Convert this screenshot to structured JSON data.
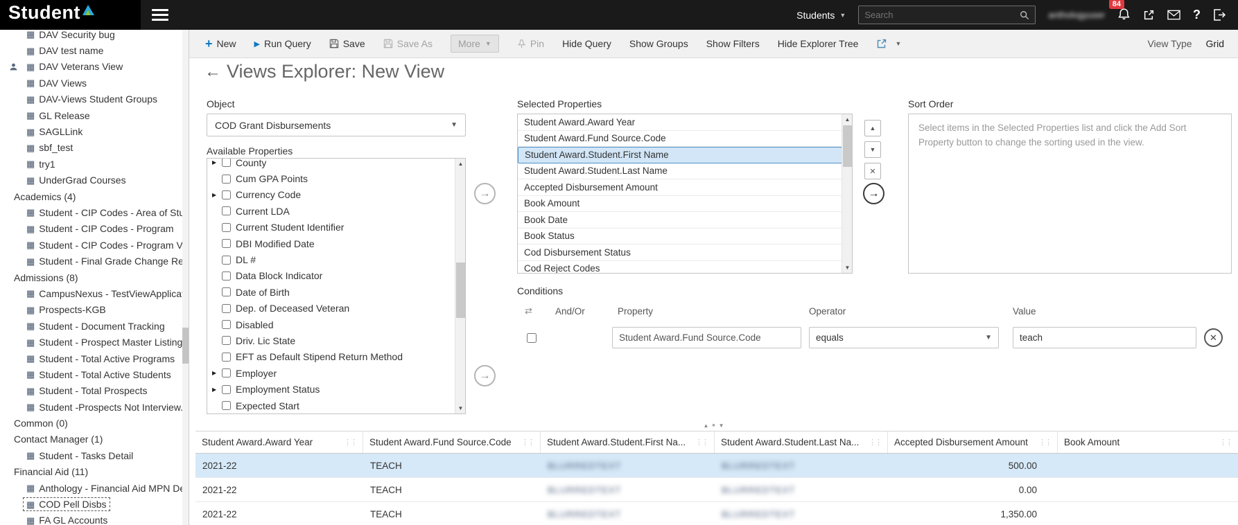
{
  "topbar": {
    "logo_text": "Student",
    "context_selector": {
      "value": "Students"
    },
    "search": {
      "placeholder": "Search"
    },
    "user_display_blurred": "anthologyuser",
    "notifications": {
      "badge": "84"
    }
  },
  "sidebar": {
    "nodes": [
      {
        "kind": "item",
        "label": "DAV Security bug"
      },
      {
        "kind": "item",
        "label": "DAV test name"
      },
      {
        "kind": "item",
        "label": "DAV Veterans View",
        "shared": true
      },
      {
        "kind": "item",
        "label": "DAV Views"
      },
      {
        "kind": "item",
        "label": "DAV-Views Student Groups"
      },
      {
        "kind": "item",
        "label": "GL Release"
      },
      {
        "kind": "item",
        "label": "SAGLLink"
      },
      {
        "kind": "item",
        "label": "sbf_test"
      },
      {
        "kind": "item",
        "label": "try1"
      },
      {
        "kind": "item",
        "label": "UnderGrad Courses"
      },
      {
        "kind": "header",
        "label": "Academics (4)"
      },
      {
        "kind": "item",
        "label": "Student - CIP Codes - Area of Stu..."
      },
      {
        "kind": "item",
        "label": "Student - CIP Codes - Program"
      },
      {
        "kind": "item",
        "label": "Student - CIP Codes - Program Ve..."
      },
      {
        "kind": "item",
        "label": "Student - Final Grade Change Rea..."
      },
      {
        "kind": "header",
        "label": "Admissions (8)"
      },
      {
        "kind": "item",
        "label": "CampusNexus - TestViewApplicat..."
      },
      {
        "kind": "item",
        "label": "Prospects-KGB"
      },
      {
        "kind": "item",
        "label": "Student - Document Tracking"
      },
      {
        "kind": "item",
        "label": "Student - Prospect Master Listing"
      },
      {
        "kind": "item",
        "label": "Student - Total Active Programs"
      },
      {
        "kind": "item",
        "label": "Student - Total Active Students"
      },
      {
        "kind": "item",
        "label": "Student - Total Prospects"
      },
      {
        "kind": "item",
        "label": "Student -Prospects Not Interview..."
      },
      {
        "kind": "header",
        "label": "Common (0)"
      },
      {
        "kind": "header",
        "label": "Contact Manager (1)"
      },
      {
        "kind": "item",
        "label": "Student - Tasks Detail"
      },
      {
        "kind": "header",
        "label": "Financial Aid (11)"
      },
      {
        "kind": "item",
        "label": "Anthology - Financial Aid MPN De..."
      },
      {
        "kind": "item",
        "label": "COD Pell Disbs",
        "focused": true
      },
      {
        "kind": "item",
        "label": "FA GL Accounts"
      }
    ]
  },
  "toolbar": {
    "new": "New",
    "run_query": "Run Query",
    "save": "Save",
    "save_as": "Save As",
    "more": "More",
    "pin": "Pin",
    "hide_query": "Hide Query",
    "show_groups": "Show Groups",
    "show_filters": "Show Filters",
    "hide_explorer_tree": "Hide Explorer Tree",
    "view_type_label": "View Type",
    "view_type_value": "Grid"
  },
  "page": {
    "title": "Views Explorer: New View"
  },
  "builder": {
    "object_label": "Object",
    "object_value": "COD Grant Disbursements",
    "available_label": "Available Properties",
    "available_items": [
      {
        "label": "County",
        "expandable": true
      },
      {
        "label": "Cum GPA Points"
      },
      {
        "label": "Currency Code",
        "expandable": true
      },
      {
        "label": "Current LDA"
      },
      {
        "label": "Current Student Identifier"
      },
      {
        "label": "DBI Modified Date"
      },
      {
        "label": "DL #"
      },
      {
        "label": "Data Block Indicator"
      },
      {
        "label": "Date of Birth"
      },
      {
        "label": "Dep. of Deceased Veteran"
      },
      {
        "label": "Disabled"
      },
      {
        "label": "Driv. Lic State"
      },
      {
        "label": "EFT as Default Stipend Return Method"
      },
      {
        "label": "Employer",
        "expandable": true
      },
      {
        "label": "Employment Status",
        "expandable": true
      },
      {
        "label": "Expected Start"
      }
    ],
    "selected_label": "Selected Properties",
    "selected_items": [
      "Student Award.Award Year",
      "Student Award.Fund Source.Code",
      "Student Award.Student.First Name",
      "Student Award.Student.Last Name",
      "Accepted Disbursement Amount",
      "Book Amount",
      "Book Date",
      "Book Status",
      "Cod Disbursement Status",
      "Cod Reject Codes"
    ],
    "selected_highlight_index": 2,
    "sort_label": "Sort Order",
    "sort_placeholder": "Select items in the Selected Properties list and click the Add Sort Property button to change the sorting used in the view."
  },
  "conditions": {
    "label": "Conditions",
    "headers": {
      "and_or": "And/Or",
      "property": "Property",
      "operator": "Operator",
      "value": "Value"
    },
    "rows": [
      {
        "property": "Student Award.Fund Source.Code",
        "operator": "equals",
        "value": "teach"
      }
    ]
  },
  "grid": {
    "columns": [
      "Student Award.Award Year",
      "Student Award.Fund Source.Code",
      "Student Award.Student.First Na...",
      "Student Award.Student.Last Na...",
      "Accepted Disbursement Amount",
      "Book Amount"
    ],
    "rows": [
      {
        "cells": [
          "2021-22",
          "TEACH",
          "BLURREDTEXT",
          "BLURREDTEXT",
          "500.00",
          ""
        ],
        "blurred": [
          2,
          3
        ],
        "selected": true
      },
      {
        "cells": [
          "2021-22",
          "TEACH",
          "BLURREDTEXT",
          "BLURREDTEXT",
          "0.00",
          ""
        ],
        "blurred": [
          2,
          3
        ],
        "selected": false
      },
      {
        "cells": [
          "2021-22",
          "TEACH",
          "BLURREDTEXT",
          "BLURREDTEXT",
          "1,350.00",
          ""
        ],
        "blurred": [
          2,
          3
        ],
        "selected": false
      }
    ]
  }
}
